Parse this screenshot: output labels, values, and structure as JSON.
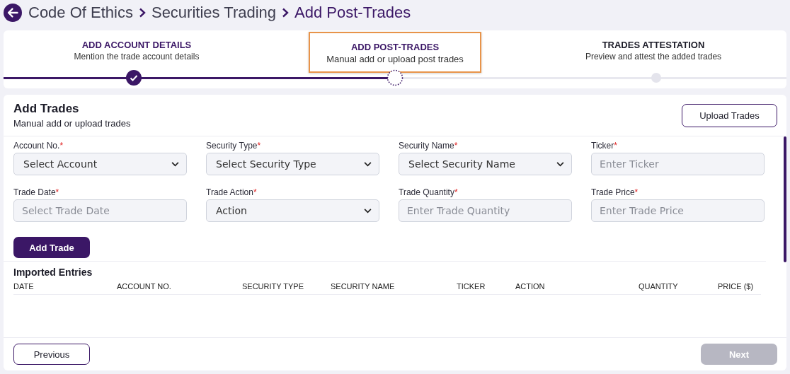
{
  "breadcrumb": {
    "items": [
      {
        "label": "Code Of Ethics",
        "current": false
      },
      {
        "label": "Securities Trading",
        "current": false
      },
      {
        "label": "Add Post-Trades",
        "current": true
      }
    ]
  },
  "stepper": {
    "steps": [
      {
        "title": "ADD ACCOUNT DETAILS",
        "subtitle": "Mention the trade account details",
        "kind": "done",
        "selected": false
      },
      {
        "title": "ADD POST-TRADES",
        "subtitle": "Manual add or upload post trades",
        "kind": "current",
        "selected": true
      },
      {
        "title": "TRADES ATTESTATION",
        "subtitle": "Preview and attest the added trades",
        "kind": "pending",
        "selected": false
      }
    ]
  },
  "form": {
    "title": "Add Trades",
    "subtitle": "Manual add or upload trades",
    "upload_button": "Upload Trades",
    "fields": [
      {
        "kind": "select",
        "label": "Account No.",
        "required_mark": "*",
        "placeholder": "Select Account"
      },
      {
        "kind": "select",
        "label": "Security Type",
        "required_mark": "*",
        "placeholder": "Select Security Type"
      },
      {
        "kind": "select",
        "label": "Security Name",
        "required_mark": "*",
        "placeholder": "Select Security Name"
      },
      {
        "kind": "input",
        "label": "Ticker",
        "required_mark": "*",
        "placeholder": "Enter Ticker"
      },
      {
        "kind": "input",
        "label": "Trade Date",
        "required_mark": "*",
        "placeholder": "Select Trade Date"
      },
      {
        "kind": "select",
        "label": "Trade Action",
        "required_mark": "*",
        "placeholder": "Action"
      },
      {
        "kind": "input",
        "label": "Trade Quantity",
        "required_mark": "*",
        "placeholder": "Enter Trade Quantity"
      },
      {
        "kind": "input",
        "label": "Trade Price",
        "required_mark": "*",
        "placeholder": "Enter Trade Price"
      }
    ],
    "add_button": "Add Trade"
  },
  "table": {
    "title": "Imported Entries",
    "columns": [
      "DATE",
      "ACCOUNT NO.",
      "SECURITY TYPE",
      "SECURITY NAME",
      "TICKER",
      "ACTION",
      "QUANTITY",
      "PRICE ($)"
    ]
  },
  "footer": {
    "previous": {
      "label": "Previous",
      "disabled": false
    },
    "next": {
      "label": "Next",
      "disabled": true
    }
  }
}
